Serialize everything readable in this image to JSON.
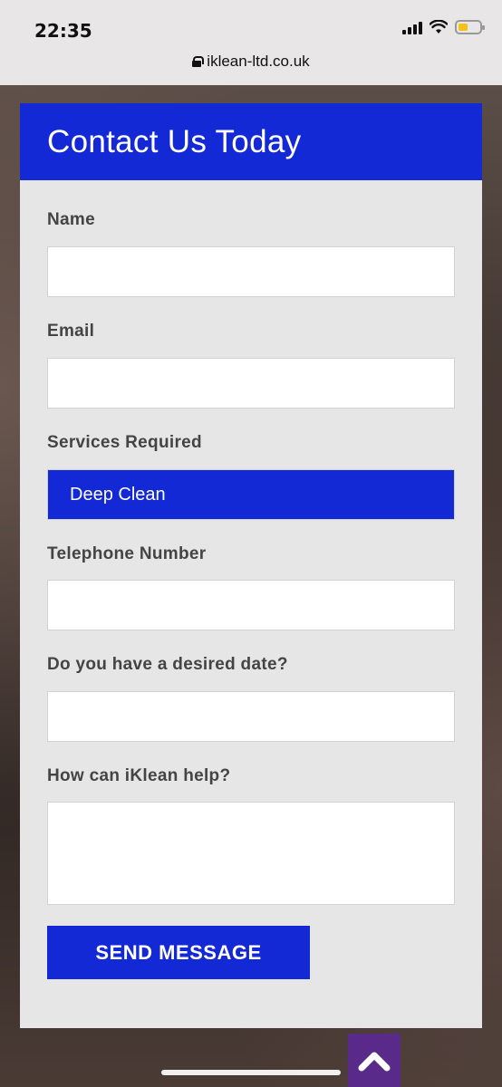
{
  "status_bar": {
    "time": "22:35",
    "url": "iklean-ltd.co.uk",
    "icons": [
      "signal-icon",
      "wifi-icon",
      "battery-icon",
      "lock-icon"
    ],
    "battery_color": "#f4c21b"
  },
  "form": {
    "title": "Contact Us Today",
    "fields": {
      "name": {
        "label": "Name",
        "value": ""
      },
      "email": {
        "label": "Email",
        "value": ""
      },
      "services": {
        "label": "Services Required",
        "value": "Deep Clean"
      },
      "telephone": {
        "label": "Telephone Number",
        "value": ""
      },
      "date": {
        "label": "Do you have a desired date?",
        "value": ""
      },
      "help": {
        "label": "How can iKlean help?",
        "value": ""
      }
    },
    "submit_label": "SEND MESSAGE"
  },
  "colors": {
    "accent": "#1429d6",
    "card_bg": "#e6e6e6",
    "scroll_top_bg": "#5a2a8a"
  },
  "scroll_top": {
    "icon": "chevron-up-icon"
  }
}
